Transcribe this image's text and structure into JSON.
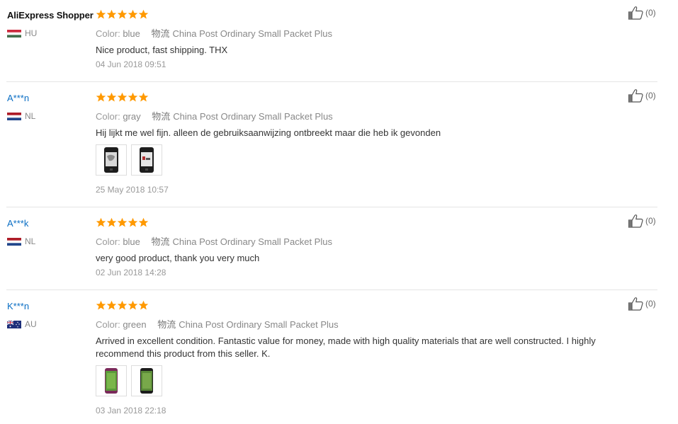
{
  "labels": {
    "color": "Color:",
    "shipping": "物流"
  },
  "reviews": [
    {
      "user": "AliExpress Shopper",
      "country": "HU",
      "flag": "hu",
      "rating": 5,
      "color": "blue",
      "shipping": "China Post Ordinary Small Packet Plus",
      "content": "Nice product, fast shipping. THX",
      "photos": [],
      "date": "04 Jun 2018 09:51",
      "likes": "(0)"
    },
    {
      "user": "A***n",
      "country": "NL",
      "flag": "nl",
      "rating": 5,
      "color": "gray",
      "shipping": "China Post Ordinary Small Packet Plus",
      "content": "Hij lijkt me wel fijn. alleen de gebruiksaanwijzing ontbreekt maar die heb ik gevonden",
      "photos": [
        "product-photo-1",
        "product-photo-2"
      ],
      "date": "25 May 2018 10:57",
      "likes": "(0)"
    },
    {
      "user": "A***k",
      "country": "NL",
      "flag": "nl",
      "rating": 5,
      "color": "blue",
      "shipping": "China Post Ordinary Small Packet Plus",
      "content": "very good product, thank you very much",
      "photos": [],
      "date": "02 Jun 2018 14:28",
      "likes": "(0)"
    },
    {
      "user": "K***n",
      "country": "AU",
      "flag": "au",
      "rating": 5,
      "color": "green",
      "shipping": "China Post Ordinary Small Packet Plus",
      "content": "Arrived in excellent condition. Fantastic value for money, made with high quality materials that are well constructed. I highly recommend this product from this seller. K.",
      "photos": [
        "product-photo-1",
        "product-photo-2"
      ],
      "date": "03 Jan 2018 22:18",
      "likes": "(0)"
    }
  ],
  "colors": {
    "star": "#ff9900",
    "link": "#0a6ec4",
    "muted": "#999999",
    "divider": "#e5e5e5"
  }
}
